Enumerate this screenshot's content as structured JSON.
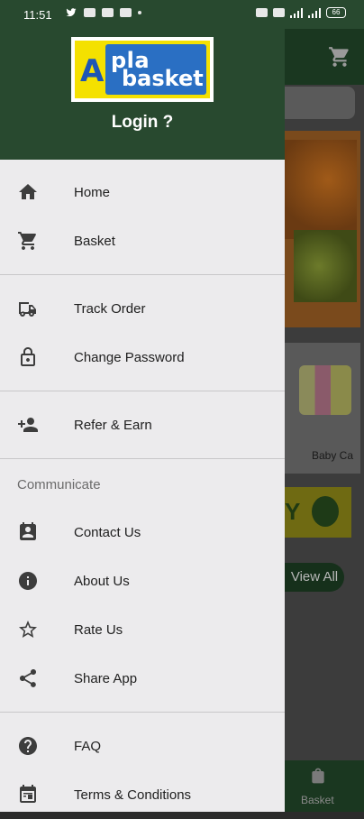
{
  "status_bar": {
    "time": "11:51",
    "battery": "66"
  },
  "drawer": {
    "logo_text": "Apla Basket",
    "login_label": "Login ?",
    "groups": [
      [
        {
          "label": "Home",
          "icon": "home-icon"
        },
        {
          "label": "Basket",
          "icon": "cart-icon"
        }
      ],
      [
        {
          "label": "Track Order",
          "icon": "truck-icon"
        },
        {
          "label": "Change Password",
          "icon": "lock-icon"
        }
      ],
      [
        {
          "label": "Refer & Earn",
          "icon": "add-person-icon"
        }
      ]
    ],
    "communicate_title": "Communicate",
    "communicate_items": [
      {
        "label": "Contact Us",
        "icon": "contact-card-icon"
      },
      {
        "label": "About Us",
        "icon": "info-icon"
      },
      {
        "label": "Rate Us",
        "icon": "star-icon"
      },
      {
        "label": "Share App",
        "icon": "share-icon"
      }
    ],
    "bottom_items": [
      {
        "label": "FAQ",
        "icon": "help-icon"
      },
      {
        "label": "Terms & Conditions",
        "icon": "calendar-icon"
      }
    ]
  },
  "background": {
    "product_label": "Baby Ca",
    "view_all_label": "View All",
    "bottom_nav_label": "Basket",
    "banner_text": "Y"
  }
}
